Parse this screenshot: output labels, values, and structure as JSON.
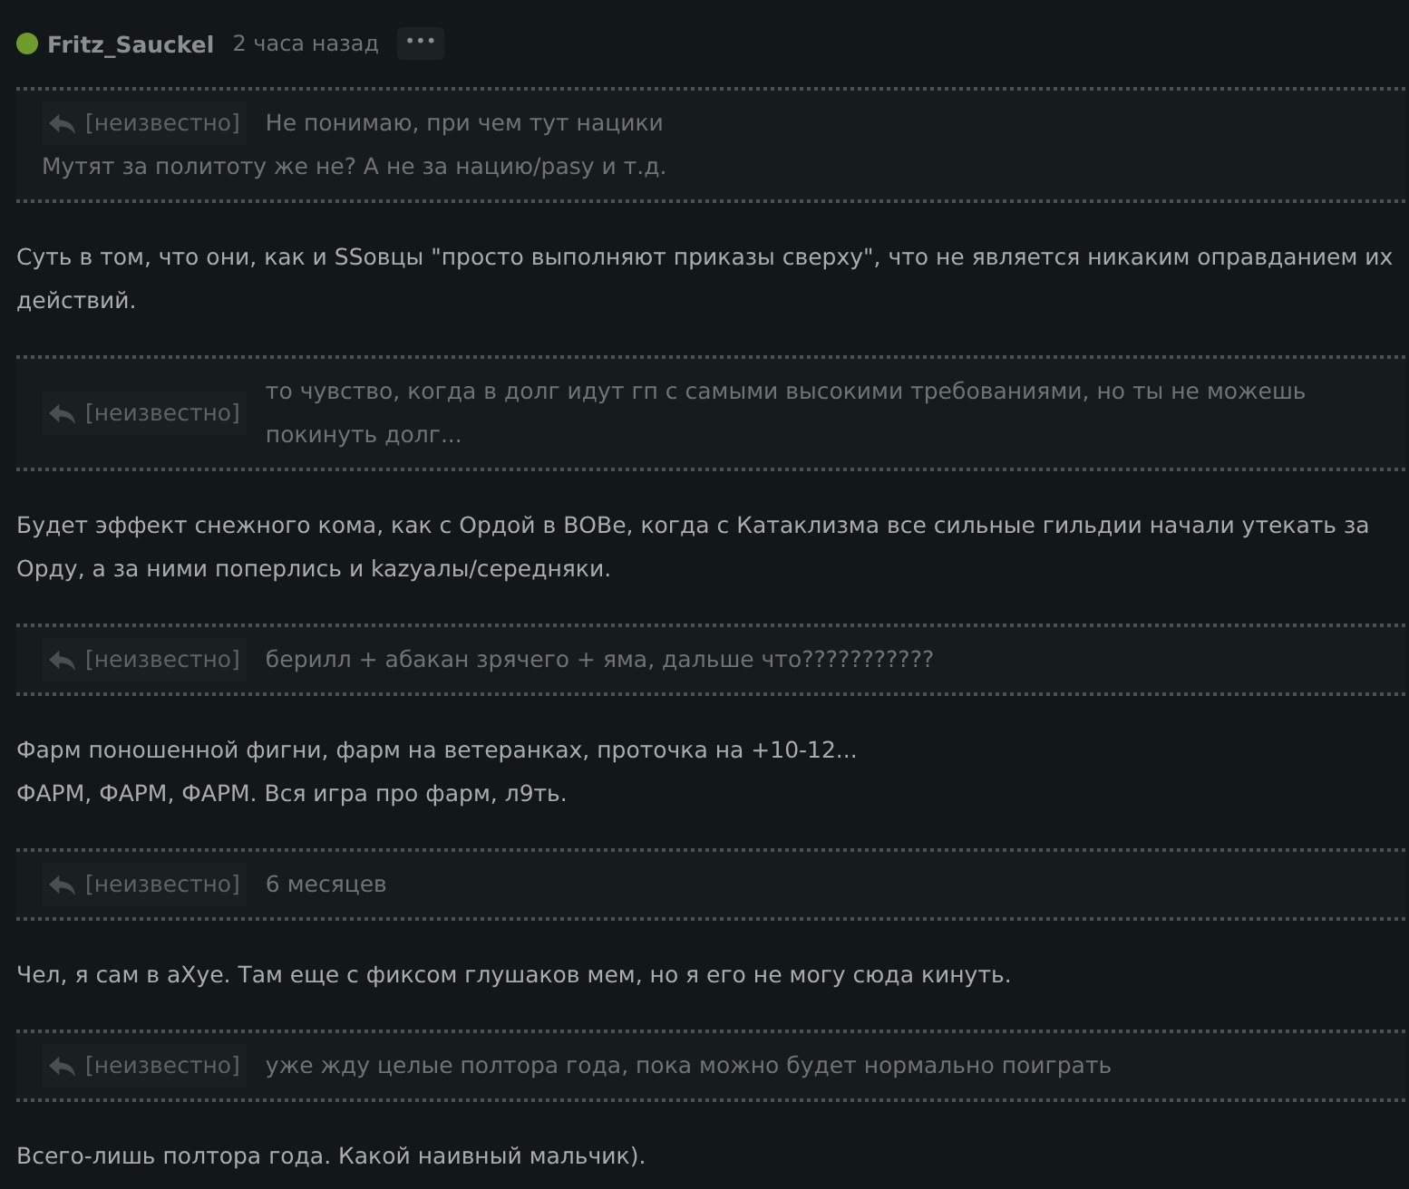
{
  "post": {
    "author": "Fritz_Sauckel",
    "online": true,
    "time": "2 часа назад",
    "menu": "•••"
  },
  "blocks": [
    {
      "kind": "quote",
      "source": "[неизвестно]",
      "lines": [
        "Не понимаю, при чем тут нацики",
        "Мутят за политоту же не? А не за нацию/pasy и т.д."
      ]
    },
    {
      "kind": "text",
      "lines": [
        "Суть в том, что они, как и SSовцы \"просто выполняют приказы сверху\", что не является никаким оправданием их действий."
      ]
    },
    {
      "kind": "quote",
      "source": "[неизвестно]",
      "lines": [
        "то чувство, когда в долг идут гп с самыми высокими требованиями, но ты не можешь покинуть долг..."
      ]
    },
    {
      "kind": "text",
      "lines": [
        "Будет эффект снежного кома, как с Ордой в ВОВе, когда с Катаклизма все сильные гильдии начали утекать за Орду, а за ними поперлись и kazyалы/середняки."
      ]
    },
    {
      "kind": "quote",
      "source": "[неизвестно]",
      "lines": [
        "берилл + абакан зрячего + яма, дальше что???????????"
      ]
    },
    {
      "kind": "text",
      "lines": [
        "Фарм поношенной фигни, фарм на ветеранках, проточка на +10-12...",
        "ФАРМ, ФАРМ, ФАРМ. Вся игра про фарм, л9ть."
      ]
    },
    {
      "kind": "quote",
      "source": "[неизвестно]",
      "lines": [
        "6 месяцев"
      ]
    },
    {
      "kind": "text",
      "lines": [
        "Чел, я сам в аХуе. Там еще с фиксом глушаков мем, но я его не могу сюда кинуть."
      ]
    },
    {
      "kind": "quote",
      "source": "[неизвестно]",
      "lines": [
        "уже жду целые полтора года, пока можно будет нормально поиграть"
      ]
    },
    {
      "kind": "text",
      "lines": [
        "Всего-лишь полтора года. Какой наивный мальчик)."
      ]
    }
  ]
}
